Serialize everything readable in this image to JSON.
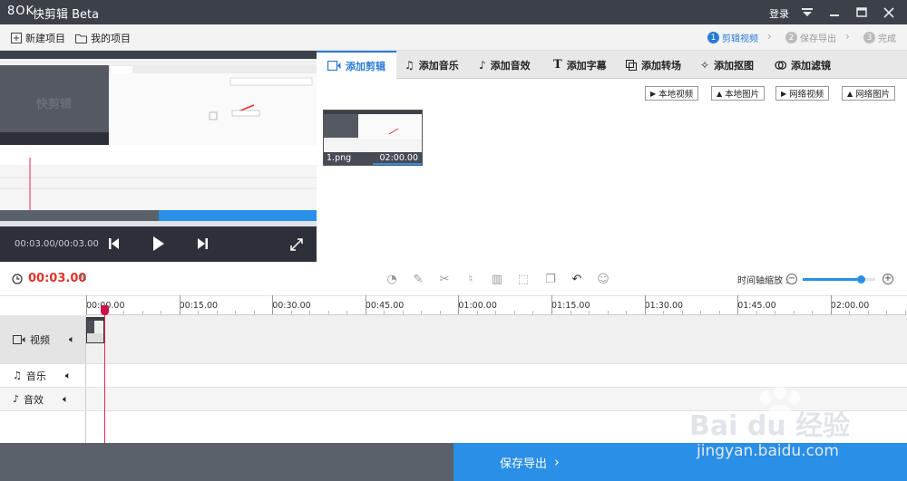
{
  "titlebar": {
    "logo": "8OK",
    "title": "快剪辑 Beta",
    "login": "登录"
  },
  "projectbar": {
    "new_project": "新建项目",
    "my_projects": "我的项目"
  },
  "steps": [
    {
      "num": "1",
      "label": "剪辑视频"
    },
    {
      "num": "2",
      "label": "保存导出"
    },
    {
      "num": "3",
      "label": "完成"
    }
  ],
  "preview": {
    "time": "00:03.00/00:03.00"
  },
  "tabs": [
    "添加剪辑",
    "添加音乐",
    "添加音效",
    "添加字幕",
    "添加转场",
    "添加抠图",
    "添加滤镜"
  ],
  "sources": [
    "本地视频",
    "本地图片",
    "网络视频",
    "网络图片"
  ],
  "clip": {
    "name": "1.png",
    "duration": "02:00.00"
  },
  "editor": {
    "current_time": "00:03.00",
    "zoom_label": "时间轴缩放 :",
    "zoom_level": 0.8
  },
  "ruler": [
    "00:00.00",
    "00:15.00",
    "00:30.00",
    "00:45.00",
    "01:00.00",
    "01:15.00",
    "01:30.00",
    "01:45.00",
    "02:00.00"
  ],
  "tracks": [
    "视频",
    "音乐",
    "音效"
  ],
  "export_label": "保存导出",
  "watermark": {
    "brand": "Bai du 经验",
    "url": "jingyan.baidu.com"
  },
  "colors": {
    "accent": "#2a7ad6",
    "time_red": "#e0342c",
    "export_blue": "#2a8fe6"
  }
}
